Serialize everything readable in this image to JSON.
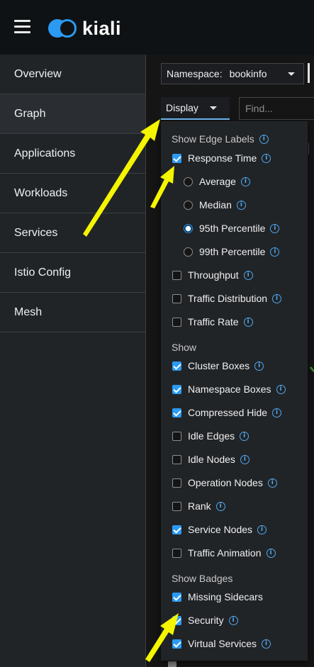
{
  "app": {
    "logo_text": "kiali"
  },
  "sidebar": {
    "items": [
      {
        "label": "Overview"
      },
      {
        "label": "Graph"
      },
      {
        "label": "Applications"
      },
      {
        "label": "Workloads"
      },
      {
        "label": "Services"
      },
      {
        "label": "Istio Config"
      },
      {
        "label": "Mesh"
      }
    ],
    "active": "Graph"
  },
  "toolbar": {
    "namespace_label": "Namespace:",
    "namespace_value": "bookinfo",
    "display_label": "Display",
    "find_placeholder": "Find..."
  },
  "display_menu": {
    "edge_labels": {
      "title": "Show Edge Labels",
      "response_time": {
        "label": "Response Time",
        "checked": true
      },
      "percentiles": [
        {
          "label": "Average",
          "selected": false
        },
        {
          "label": "Median",
          "selected": false
        },
        {
          "label": "95th Percentile",
          "selected": true
        },
        {
          "label": "99th Percentile",
          "selected": false
        }
      ],
      "others": [
        {
          "label": "Throughput",
          "checked": false
        },
        {
          "label": "Traffic Distribution",
          "checked": false
        },
        {
          "label": "Traffic Rate",
          "checked": false
        }
      ]
    },
    "show": {
      "title": "Show",
      "items": [
        {
          "label": "Cluster Boxes",
          "checked": true
        },
        {
          "label": "Namespace Boxes",
          "checked": true
        },
        {
          "label": "Compressed Hide",
          "checked": true
        },
        {
          "label": "Idle Edges",
          "checked": false
        },
        {
          "label": "Idle Nodes",
          "checked": false
        },
        {
          "label": "Operation Nodes",
          "checked": false
        },
        {
          "label": "Rank",
          "checked": false
        },
        {
          "label": "Service Nodes",
          "checked": true
        },
        {
          "label": "Traffic Animation",
          "checked": false
        }
      ]
    },
    "badges": {
      "title": "Show Badges",
      "items": [
        {
          "label": "Missing Sidecars",
          "checked": true
        },
        {
          "label": "Security",
          "checked": true
        },
        {
          "label": "Virtual Services",
          "checked": true
        }
      ]
    }
  },
  "colors": {
    "accent": "#2b9af3",
    "annotation_arrow": "#f5f500"
  }
}
